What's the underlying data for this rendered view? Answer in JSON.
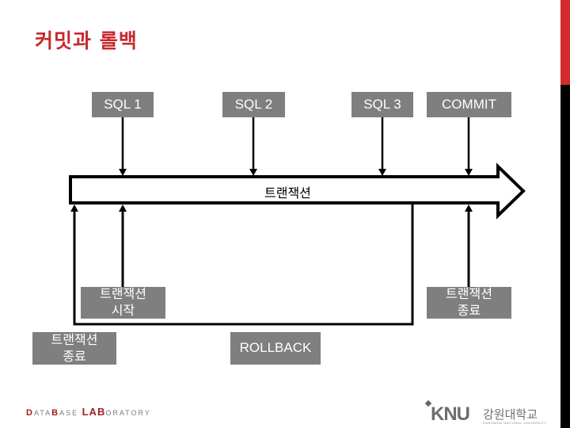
{
  "slide": {
    "title": "커밋과 롤백",
    "accent_color": "#c8282e",
    "box_color": "#7f7f7f"
  },
  "diagram": {
    "arrow_label": "트랜잭션",
    "top_steps": [
      {
        "id": "sql1",
        "label": "SQL 1"
      },
      {
        "id": "sql2",
        "label": "SQL 2"
      },
      {
        "id": "sql3",
        "label": "SQL 3"
      },
      {
        "id": "commit",
        "label": "COMMIT"
      }
    ],
    "tx_start": {
      "line1": "트랜잭션",
      "line2": "시작"
    },
    "tx_end_right": {
      "line1": "트랜잭션",
      "line2": "종료"
    },
    "tx_end_left": {
      "line1": "트랜잭션",
      "line2": "종료"
    },
    "rollback": {
      "label": "ROLLBACK"
    }
  },
  "footer": {
    "lab": {
      "d": "D",
      "ata": "ATA",
      "b": "B",
      "ase": "ASE",
      "lab": "LAB",
      "oratory": "ORATORY"
    },
    "university": {
      "mark": "KNU",
      "name_ko": "강원대학교",
      "name_en": "KANGWON NATIONAL UNIVERSITY"
    }
  }
}
